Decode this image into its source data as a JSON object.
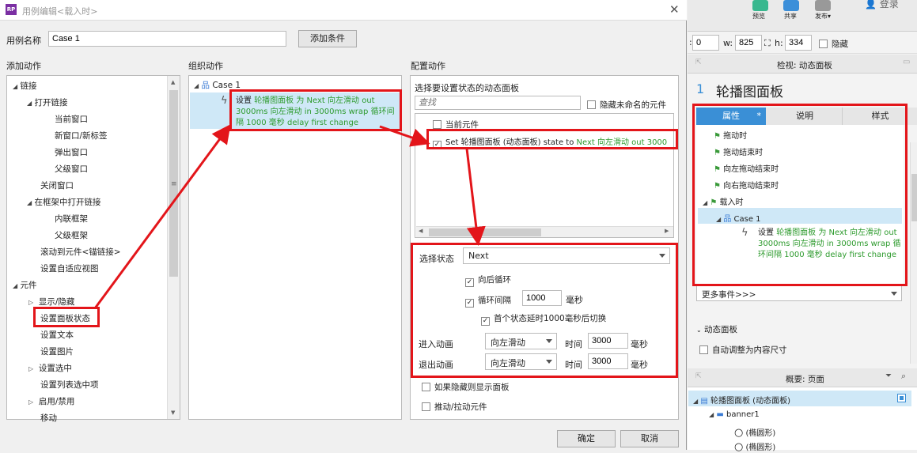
{
  "dialog": {
    "title": "用例编辑<载入时>",
    "case_name_label": "用例名称",
    "case_name_value": "Case 1",
    "add_condition": "添加条件",
    "ok": "确定",
    "cancel": "取消"
  },
  "add_actions": {
    "header": "添加动作",
    "items": [
      "链接",
      "打开链接",
      "当前窗口",
      "新窗口/新标签",
      "弹出窗口",
      "父级窗口",
      "关闭窗口",
      "在框架中打开链接",
      "内联框架",
      "父级框架",
      "滚动到元件<锚链接>",
      "设置自适应视图",
      "元件",
      "显示/隐藏",
      "设置面板状态",
      "设置文本",
      "设置图片",
      "设置选中",
      "设置列表选中项",
      "启用/禁用",
      "移动"
    ]
  },
  "organize": {
    "header": "组织动作",
    "case": "Case 1",
    "action_prefix": "设置 ",
    "action_green": "轮播图面板 为 Next 向左滑动 out 3000ms 向左滑动 in 3000ms wrap 循环间隔 1000 毫秒 delay first change"
  },
  "configure": {
    "header": "配置动作",
    "select_panel": "选择要设置状态的动态面板",
    "search_placeholder": "查找",
    "hide_unnamed": "隐藏未命名的元件",
    "current_element": "当前元件",
    "set_item_prefix": "Set 轮播图面板 (动态面板) state to ",
    "set_item_green": "Next 向左滑动 out 3000",
    "select_state_label": "选择状态",
    "select_state_value": "Next",
    "wrap_label": "向后循环",
    "loop_label": "循环间隔",
    "loop_value": "1000",
    "ms": "毫秒",
    "first_delay": "首个状态延时1000毫秒后切换",
    "enter_anim": "进入动画",
    "exit_anim": "退出动画",
    "anim_value": "向左滑动",
    "time": "时间",
    "time_value": "3000",
    "show_if_hidden": "如果隐藏则显示面板",
    "push_pull": "推动/拉动元件"
  },
  "right": {
    "toolbar": [
      "预览",
      "共享",
      "发布▾"
    ],
    "login": "登录",
    "x_value": "0",
    "w_label": "w:",
    "w_value": "825",
    "h_label": "h:",
    "h_value": "334",
    "hide": "隐藏",
    "inspect_title": "检视: 动态面板",
    "num": "1",
    "panel_name": "轮播图面板",
    "tabs": [
      "属性",
      "说明",
      "样式"
    ],
    "tab_star": "*",
    "events": [
      "拖动时",
      "拖动结束时",
      "向左拖动结束时",
      "向右拖动结束时",
      "载入时"
    ],
    "case": "Case 1",
    "action_prefix": "设置 ",
    "action_green": "轮播图面板 为 Next 向左滑动 out 3000ms 向左滑动 in 3000ms wrap 循环间隔 1000 毫秒 delay first change",
    "more_events": "更多事件>>>",
    "dp_section": "动态面板",
    "auto_size": "自动调整为内容尺寸",
    "outline_title": "概要: 页面",
    "outline_items": [
      "轮播图面板 (动态面板)",
      "banner1",
      "(椭圆形)",
      "(椭圆形)"
    ]
  },
  "colors": {
    "red": "#e3151a",
    "tab_blue": "#3a8fd6",
    "green": "#2e9b2e"
  }
}
